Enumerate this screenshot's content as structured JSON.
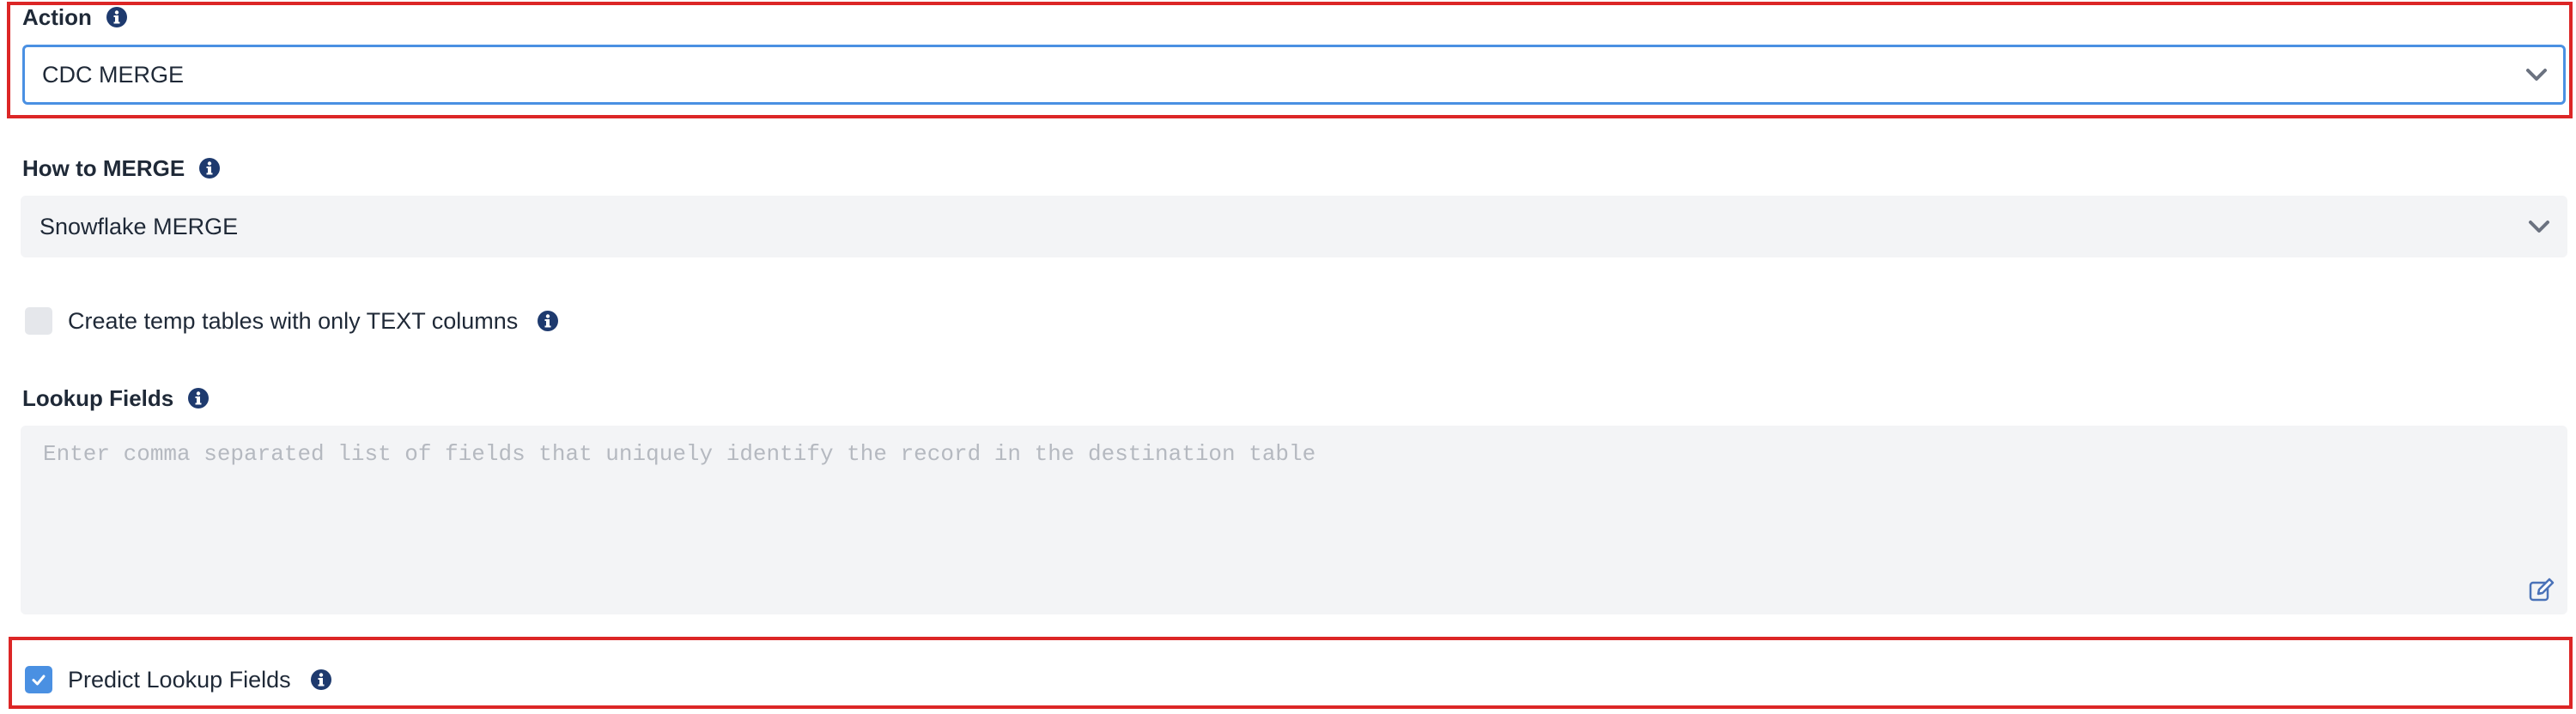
{
  "action": {
    "label": "Action",
    "info_icon": "info-circle-icon",
    "selected_value": "CDC MERGE",
    "focused": true,
    "highlighted": true
  },
  "how_to_merge": {
    "label": "How to MERGE",
    "info_icon": "info-circle-icon",
    "selected_value": "Snowflake MERGE"
  },
  "temp_tables": {
    "label": "Create temp tables with only TEXT columns",
    "checked": false,
    "info_icon": "info-circle-icon"
  },
  "lookup_fields": {
    "label": "Lookup Fields",
    "info_icon": "info-circle-icon",
    "value": "",
    "placeholder": "Enter comma separated list of fields that uniquely identify the record in the destination table",
    "edit_icon": "edit-icon"
  },
  "predict_lookup": {
    "label": "Predict Lookup Fields",
    "checked": true,
    "info_icon": "info-circle-icon",
    "highlighted": true
  },
  "colors": {
    "highlight_border": "#dc2626",
    "accent_blue": "#4a90e2",
    "info_icon": "#1e3a6e",
    "field_background": "#f3f4f6",
    "text": "#1f2937",
    "placeholder": "#b5b9c0"
  }
}
